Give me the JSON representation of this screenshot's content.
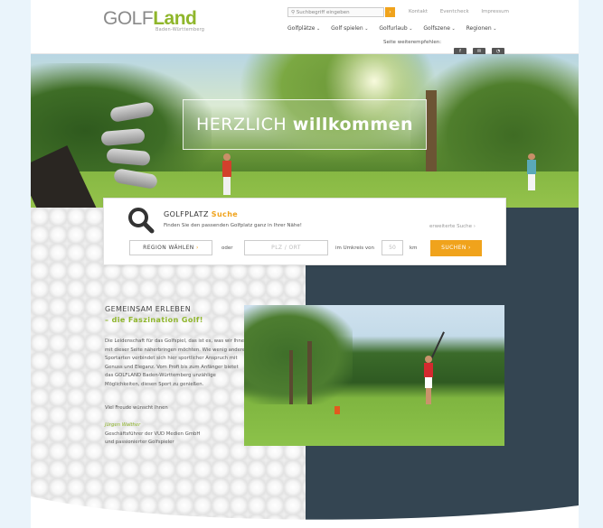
{
  "header": {
    "logo": {
      "golf": "GOLF",
      "land": "Land",
      "region": "Baden-Württemberg"
    },
    "search": {
      "placeholder": "Suchbegriff eingeben",
      "button": "›"
    },
    "toplinks": [
      "Kontakt",
      "Eventcheck",
      "Impressum"
    ],
    "nav": [
      "Golfplätze",
      "Golf spielen",
      "Golfurlaub",
      "Golfszene",
      "Regionen"
    ],
    "share": {
      "label": "Seite weiterempfehlen:",
      "icons": [
        "facebook-icon",
        "mail-icon",
        "whatsapp-icon"
      ]
    }
  },
  "hero": {
    "welcome_light": "HERZLICH",
    "welcome_bold": "willkommen"
  },
  "golfplatz_search": {
    "title_plain": "GOLFPLATZ",
    "title_accent": "Suche",
    "subtitle": "Finden Sie den passenden Golfplatz ganz in Ihrer Nähe!",
    "advanced": "erweiterte Suche ›",
    "region_button": "REGION WÄHLEN",
    "region_chevron": "›",
    "or": "oder",
    "plz_placeholder": "PLZ / ORT",
    "radius_label": "im Umkreis von",
    "radius_value": "50",
    "unit": "km",
    "submit": "SUCHEN ›"
  },
  "intro": {
    "heading": "GEMEINSAM ERLEBEN",
    "subheading": "– die Faszination Golf!",
    "body": "Die Leidenschaft für das Golfspiel, das ist es, was wir Ihnen mit dieser Seite näherbringen möchten. Wie wenig andere Sportarten verbindet sich hier sportlicher Anspruch mit Genuss und Eleganz. Vom Profi bis zum Anfänger bietet das GOLFLAND Baden-Württemberg unzählige Möglichkeiten, diesen Sport zu genießen.",
    "greeting": "Viel Freude wünscht Ihnen",
    "name": "Jürgen Walther",
    "role_1": "Geschäftsführer der VUD Medien GmbH",
    "role_2": "und passionierter Golfspieler"
  },
  "colors": {
    "accent": "#f0a31c",
    "brand_green": "#8fb62b",
    "dark_panel": "#344552"
  }
}
